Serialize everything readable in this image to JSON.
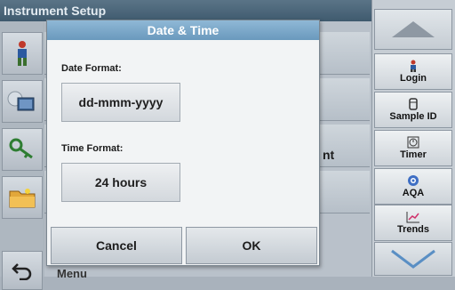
{
  "background": {
    "title": "Instrument Setup",
    "row_text_partial": "nt",
    "menu_text_partial": "Menu"
  },
  "dialog": {
    "title": "Date & Time",
    "date_format_label": "Date Format:",
    "date_format_value": "dd-mmm-yyyy",
    "time_format_label": "Time Format:",
    "time_format_value": "24 hours",
    "cancel_label": "Cancel",
    "ok_label": "OK"
  },
  "sidebar": {
    "items": [
      {
        "label": "Login",
        "icon": "user-icon"
      },
      {
        "label": "Sample ID",
        "icon": "sample-id-icon"
      },
      {
        "label": "Timer",
        "icon": "timer-icon"
      },
      {
        "label": "AQA",
        "icon": "aqa-icon"
      },
      {
        "label": "Trends",
        "icon": "trends-icon"
      }
    ]
  },
  "colors": {
    "dialog_title_bg": "#7aa8cb",
    "accent_arrow": "#5a8fc4"
  }
}
